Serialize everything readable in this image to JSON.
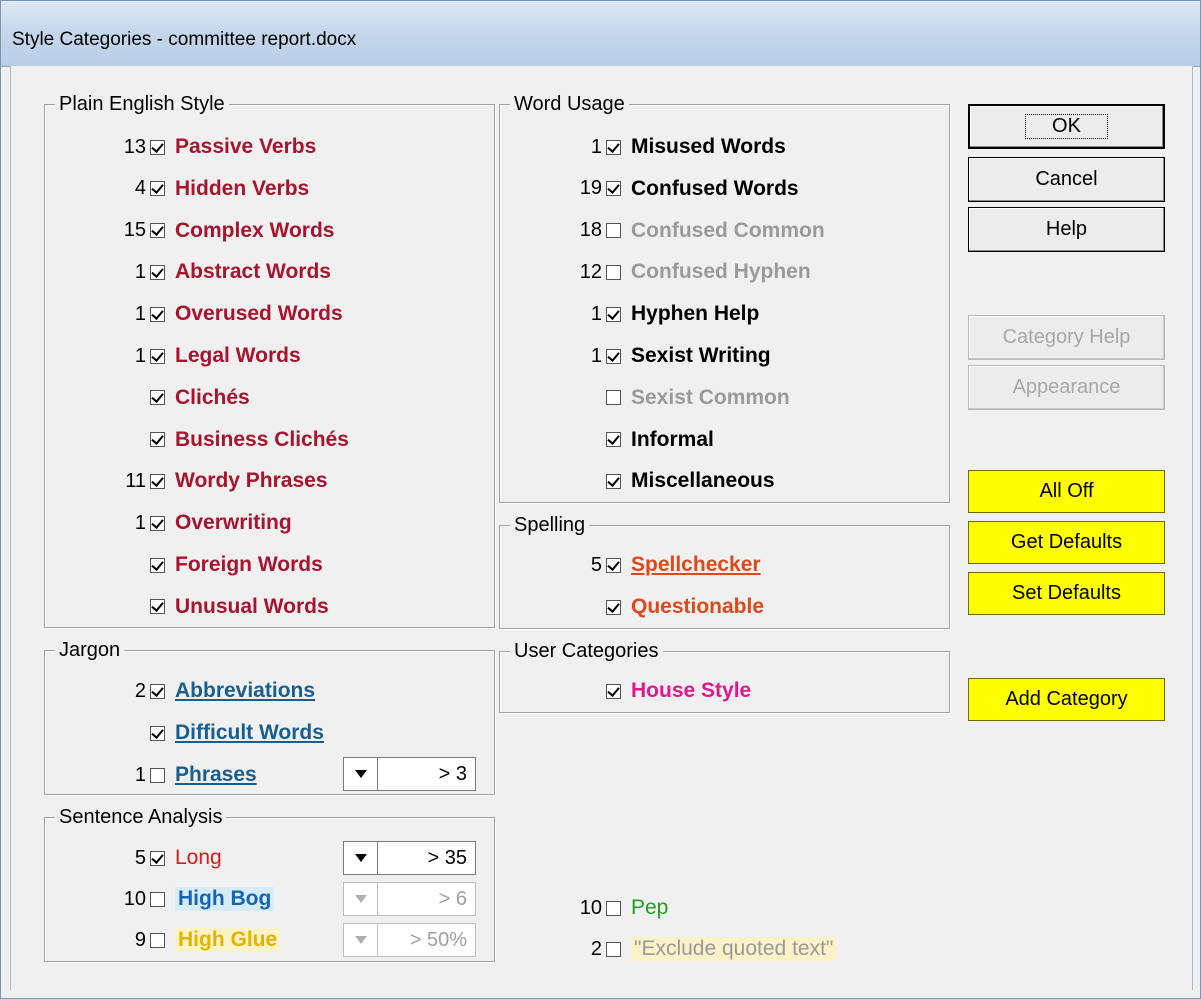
{
  "window": {
    "title": "Style Categories - committee report.docx"
  },
  "plain_english": {
    "legend": "Plain English Style",
    "items": [
      {
        "count": "13",
        "checked": true,
        "label": "Passive Verbs"
      },
      {
        "count": "4",
        "checked": true,
        "label": "Hidden Verbs"
      },
      {
        "count": "15",
        "checked": true,
        "label": "Complex Words"
      },
      {
        "count": "1",
        "checked": true,
        "label": "Abstract Words"
      },
      {
        "count": "1",
        "checked": true,
        "label": "Overused Words"
      },
      {
        "count": "1",
        "checked": true,
        "label": "Legal Words"
      },
      {
        "count": "",
        "checked": true,
        "label": "Clichés"
      },
      {
        "count": "",
        "checked": true,
        "label": "Business Clichés"
      },
      {
        "count": "11",
        "checked": true,
        "label": "Wordy Phrases"
      },
      {
        "count": "1",
        "checked": true,
        "label": "Overwriting"
      },
      {
        "count": "",
        "checked": true,
        "label": "Foreign Words"
      },
      {
        "count": "",
        "checked": true,
        "label": "Unusual Words"
      }
    ]
  },
  "word_usage": {
    "legend": "Word Usage",
    "items": [
      {
        "count": "1",
        "checked": true,
        "label": "Misused Words"
      },
      {
        "count": "19",
        "checked": true,
        "label": "Confused Words"
      },
      {
        "count": "18",
        "checked": false,
        "label": "Confused Common"
      },
      {
        "count": "12",
        "checked": false,
        "label": "Confused Hyphen"
      },
      {
        "count": "1",
        "checked": true,
        "label": "Hyphen Help"
      },
      {
        "count": "1",
        "checked": true,
        "label": "Sexist Writing"
      },
      {
        "count": "",
        "checked": false,
        "label": "Sexist Common"
      },
      {
        "count": "",
        "checked": true,
        "label": "Informal"
      },
      {
        "count": "",
        "checked": true,
        "label": "Miscellaneous"
      }
    ]
  },
  "spelling": {
    "legend": "Spelling",
    "items": [
      {
        "count": "5",
        "checked": true,
        "label": "Spellchecker"
      },
      {
        "count": "",
        "checked": true,
        "label": "Questionable"
      }
    ]
  },
  "user_categories": {
    "legend": "User Categories",
    "items": [
      {
        "count": "",
        "checked": true,
        "label": "House Style"
      }
    ]
  },
  "jargon": {
    "legend": "Jargon",
    "items": [
      {
        "count": "2",
        "checked": true,
        "label": "Abbreviations"
      },
      {
        "count": "",
        "checked": true,
        "label": "Difficult Words"
      },
      {
        "count": "1",
        "checked": false,
        "label": "Phrases",
        "combo": "> 3"
      }
    ]
  },
  "sentence_analysis": {
    "legend": "Sentence Analysis",
    "items": [
      {
        "count": "5",
        "checked": true,
        "label": "Long",
        "combo": "> 35"
      },
      {
        "count": "10",
        "checked": false,
        "label": "High Bog",
        "combo": "> 6"
      },
      {
        "count": "9",
        "checked": false,
        "label": "High Glue",
        "combo": "> 50%"
      }
    ]
  },
  "extras": {
    "pep": {
      "count": "10",
      "checked": false,
      "label": "Pep"
    },
    "exclude_quoted": {
      "count": "2",
      "checked": false,
      "label": "\"Exclude quoted text\""
    }
  },
  "buttons": {
    "ok": "OK",
    "cancel": "Cancel",
    "help": "Help",
    "category_help": "Category Help",
    "appearance": "Appearance",
    "all_off": "All Off",
    "get_defaults": "Get Defaults",
    "set_defaults": "Set Defaults",
    "add_category": "Add Category"
  },
  "colors": {
    "plain_english": "#a8142e",
    "word_usage": "#000000",
    "disabled_text": "#9a9a9a",
    "jargon_link": "#1a5e8f",
    "spelling": "#e0481c",
    "user_category": "#e0188e",
    "yellow_button": "#ffff00"
  }
}
